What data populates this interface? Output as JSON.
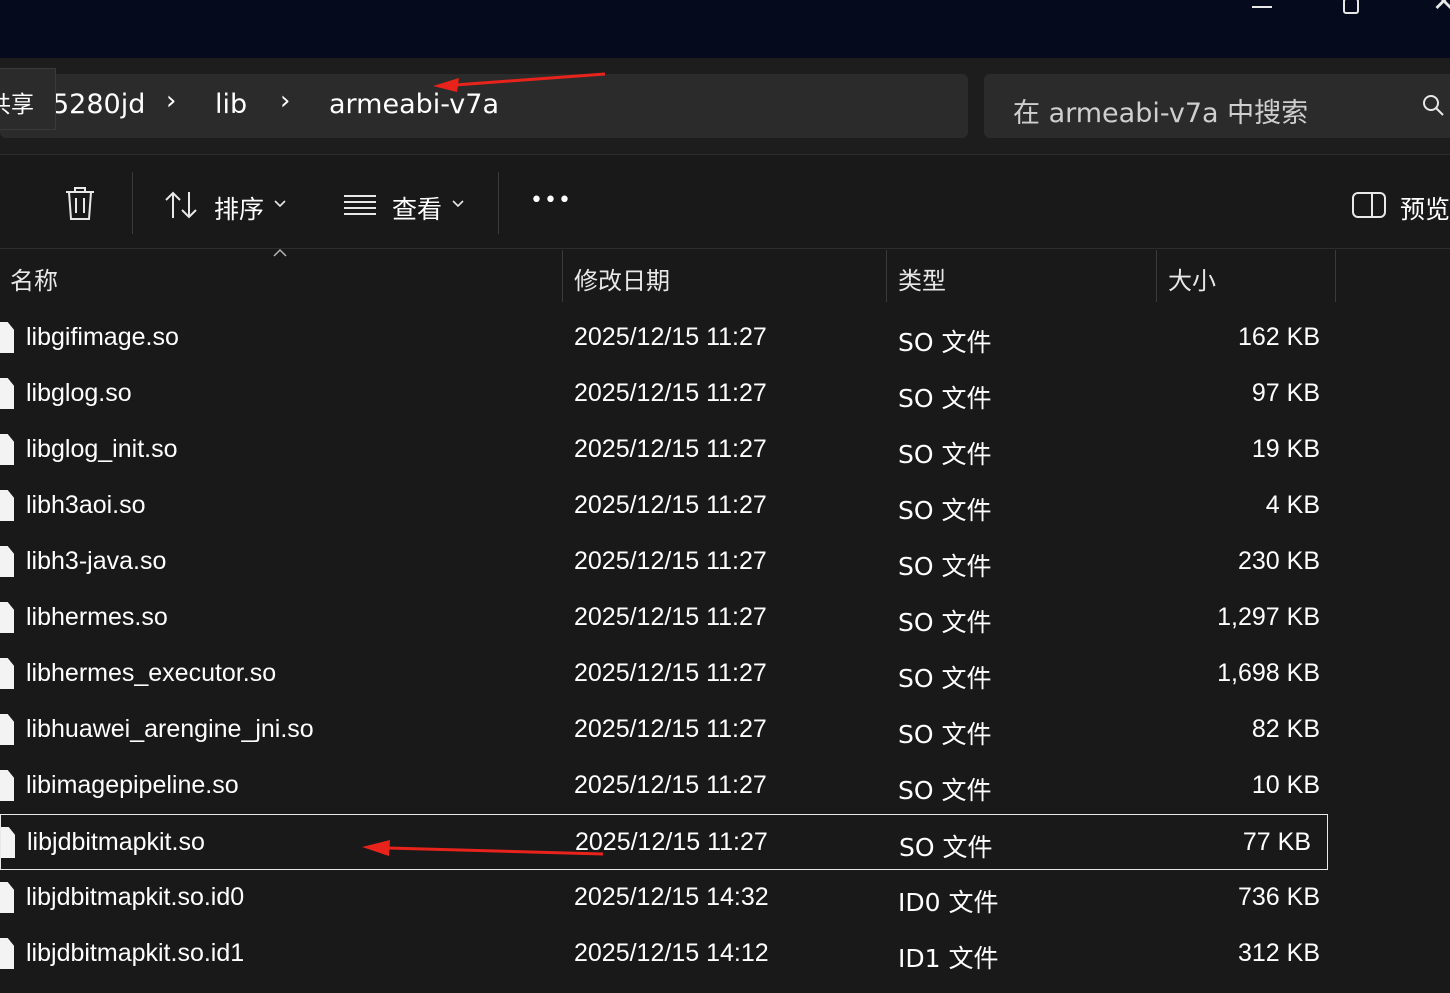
{
  "window": {
    "minimize_icon": "minimize-icon",
    "maximize_icon": "maximize-icon",
    "close_icon": "close-icon",
    "close_glyph": "✕"
  },
  "address": {
    "tooltip": "共享",
    "crumbs": [
      "5280jd",
      "lib",
      "armeabi-v7a"
    ],
    "separator": "›"
  },
  "search": {
    "placeholder": "在 armeabi-v7a 中搜索"
  },
  "toolbar": {
    "sort_label": "排序",
    "view_label": "查看",
    "more_label": "•••",
    "preview_label": "预览"
  },
  "columns": {
    "name": "名称",
    "date": "修改日期",
    "type": "类型",
    "size": "大小"
  },
  "files": [
    {
      "name": "libgifimage.so",
      "date": "2025/12/15 11:27",
      "type": "SO 文件",
      "size": "162 KB"
    },
    {
      "name": "libglog.so",
      "date": "2025/12/15 11:27",
      "type": "SO 文件",
      "size": "97 KB"
    },
    {
      "name": "libglog_init.so",
      "date": "2025/12/15 11:27",
      "type": "SO 文件",
      "size": "19 KB"
    },
    {
      "name": "libh3aoi.so",
      "date": "2025/12/15 11:27",
      "type": "SO 文件",
      "size": "4 KB"
    },
    {
      "name": "libh3-java.so",
      "date": "2025/12/15 11:27",
      "type": "SO 文件",
      "size": "230 KB"
    },
    {
      "name": "libhermes.so",
      "date": "2025/12/15 11:27",
      "type": "SO 文件",
      "size": "1,297 KB"
    },
    {
      "name": "libhermes_executor.so",
      "date": "2025/12/15 11:27",
      "type": "SO 文件",
      "size": "1,698 KB"
    },
    {
      "name": "libhuawei_arengine_jni.so",
      "date": "2025/12/15 11:27",
      "type": "SO 文件",
      "size": "82 KB"
    },
    {
      "name": "libimagepipeline.so",
      "date": "2025/12/15 11:27",
      "type": "SO 文件",
      "size": "10 KB"
    },
    {
      "name": "libjdbitmapkit.so",
      "date": "2025/12/15 11:27",
      "type": "SO 文件",
      "size": "77 KB"
    },
    {
      "name": "libjdbitmapkit.so.id0",
      "date": "2025/12/15 14:32",
      "type": "ID0 文件",
      "size": "736 KB"
    },
    {
      "name": "libjdbitmapkit.so.id1",
      "date": "2025/12/15 14:12",
      "type": "ID1 文件",
      "size": "312 KB"
    }
  ],
  "selected_index": 9,
  "colors": {
    "background": "#191919",
    "titlebar": "#050b1c",
    "annotation_arrow": "#e8231c"
  }
}
